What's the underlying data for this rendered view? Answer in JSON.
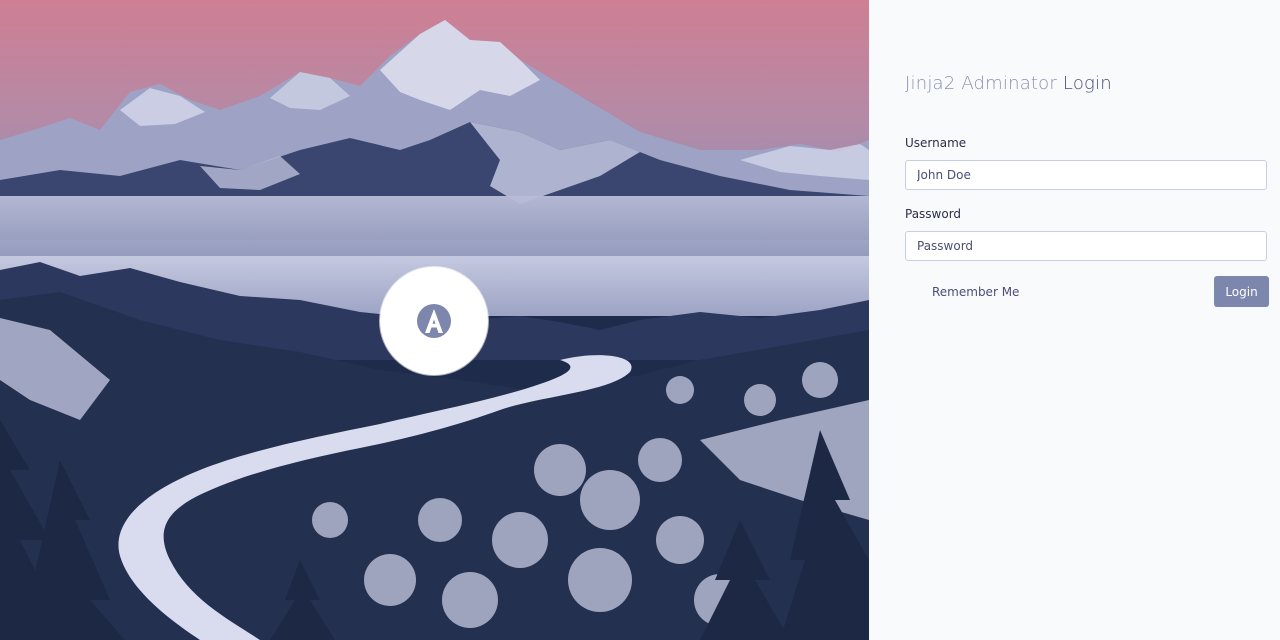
{
  "hero": {
    "logo_icon": "adminator-logo-icon",
    "logo_letter": "A"
  },
  "login": {
    "title_brand": "Jinja2 Adminator",
    "title_rest": " Login",
    "username_label": "Username",
    "username_placeholder": "John Doe",
    "password_label": "Password",
    "password_placeholder": "Password",
    "remember_label": "Remember Me",
    "remember_checked": false,
    "submit_label": "Login"
  },
  "colors": {
    "accent": "#7d86ad",
    "title_brand": "#8a90b4",
    "title_rest": "#4a4f75",
    "panel_bg": "#f9fafc"
  }
}
